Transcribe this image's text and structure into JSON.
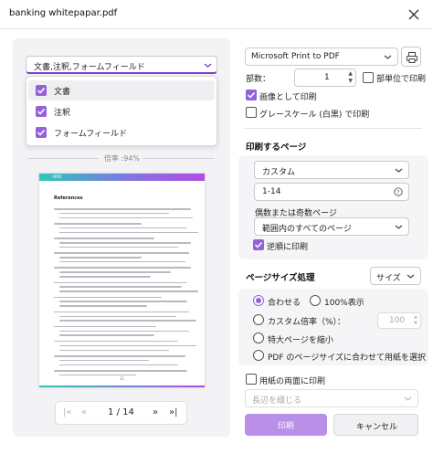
{
  "window": {
    "title": "banking whitepapar.pdf"
  },
  "preview": {
    "content_select": {
      "value": "文書,注釈,フォームフィールド"
    },
    "content_options": [
      {
        "label": "文書",
        "checked": true
      },
      {
        "label": "注釈",
        "checked": true
      },
      {
        "label": "フォームフィールド",
        "checked": true
      }
    ],
    "zoom_label": "倍率 :94%",
    "page_header_tag": "UPDF",
    "page_heading": "References",
    "page_footer_num": "11",
    "pager": {
      "current": "1",
      "separator": "/",
      "total": "14"
    }
  },
  "settings": {
    "printer": "Microsoft Print to PDF",
    "copies_label": "部数：",
    "copies_value": "1",
    "collate_label": "部単位で印刷",
    "collate_checked": false,
    "print_as_image_label": "画像として印刷",
    "print_as_image_checked": true,
    "grayscale_label": "グレースケール (白黒) で印刷",
    "grayscale_checked": false
  },
  "pages_section": {
    "title": "印刷するページ",
    "range_select": "カスタム",
    "range_value": "1-14",
    "odd_even_label": "偶数または奇数ページ",
    "odd_even_select": "範囲内のすべてのページ",
    "reverse_label": "逆順に印刷",
    "reverse_checked": true
  },
  "size_section": {
    "title": "ページサイズ処理",
    "mode_select": "サイズ",
    "options": {
      "fit": "合わせる",
      "actual": "100%表示",
      "custom_scale": "カスタム倍率（%）：",
      "shrink": "特大ページを縮小",
      "pdf_size": "PDF のページサイズに合わせて用紙を選択"
    },
    "custom_scale_value": "100",
    "selected": "fit"
  },
  "duplex": {
    "label": "用紙の両面に印刷",
    "checked": false,
    "select_placeholder": "長辺を綴じる"
  },
  "buttons": {
    "print": "印刷",
    "cancel": "キャンセル"
  },
  "colors": {
    "accent": "#9263d8",
    "accent_light": "#b98fe8"
  }
}
